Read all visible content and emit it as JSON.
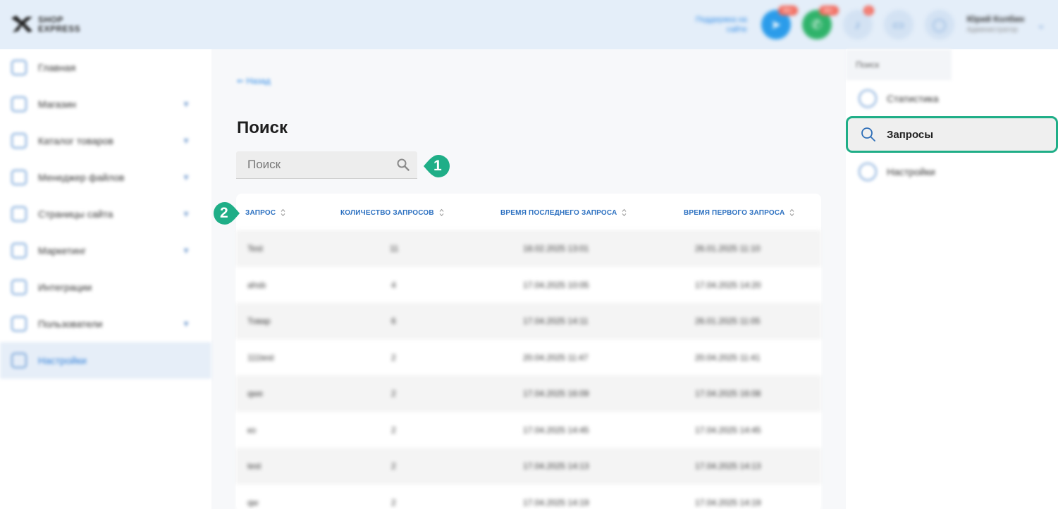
{
  "header": {
    "logo_text_1": "SHOP",
    "logo_text_2": "EXPRESS",
    "support_link_line1": "Поддержка на",
    "support_link_line2": "сайте",
    "telegram_badge": "99+",
    "whatsapp_badge": "99+",
    "notifications_badge": "1",
    "user_name": "Юрий Колбин",
    "user_role": "Администратор"
  },
  "sidebar": {
    "items": [
      {
        "label": "Главная"
      },
      {
        "label": "Магазин"
      },
      {
        "label": "Каталог товаров"
      },
      {
        "label": "Менеджер файлов"
      },
      {
        "label": "Страницы сайта"
      },
      {
        "label": "Маркетинг"
      },
      {
        "label": "Интеграции"
      },
      {
        "label": "Пользователи"
      },
      {
        "label": "Настройки"
      }
    ]
  },
  "main": {
    "breadcrumb": "Назад",
    "title": "Поиск",
    "search_placeholder": "Поиск",
    "callout_1": "1",
    "callout_2": "2",
    "columns": [
      "ЗАПРОС",
      "КОЛИЧЕСТВО ЗАПРОСОВ",
      "ВРЕМЯ ПОСЛЕДНЕГО ЗАПРОСА",
      "ВРЕМЯ ПЕРВОГО ЗАПРОСА"
    ],
    "rows": [
      {
        "query": "Test",
        "count": "11",
        "last": "18.02.2025 13:01",
        "first": "26.01.2025 11:10"
      },
      {
        "query": "ahsb",
        "count": "4",
        "last": "17.04.2025 10:05",
        "first": "17.04.2025 14:20"
      },
      {
        "query": "Товар",
        "count": "6",
        "last": "17.04.2025 14:11",
        "first": "26.01.2025 11:05"
      },
      {
        "query": "111test",
        "count": "2",
        "last": "20.04.2025 11:47",
        "first": "20.04.2025 11:41"
      },
      {
        "query": "qwe",
        "count": "2",
        "last": "17.04.2025 16:09",
        "first": "17.04.2025 16:08"
      },
      {
        "query": "ко",
        "count": "2",
        "last": "17.04.2025 14:45",
        "first": "17.04.2025 14:45"
      },
      {
        "query": "test",
        "count": "2",
        "last": "17.04.2025 14:13",
        "first": "17.04.2025 14:13"
      },
      {
        "query": "qw",
        "count": "2",
        "last": "17.04.2025 14:19",
        "first": "17.04.2025 14:19"
      }
    ]
  },
  "right_panel": {
    "header": "Поиск",
    "items": [
      {
        "label": "Статистика"
      },
      {
        "label": "Запросы"
      },
      {
        "label": "Настройки"
      }
    ]
  },
  "colors": {
    "accent": "#2f7fd8",
    "highlight": "#1fae87",
    "header_bg": "#e4eef9"
  }
}
